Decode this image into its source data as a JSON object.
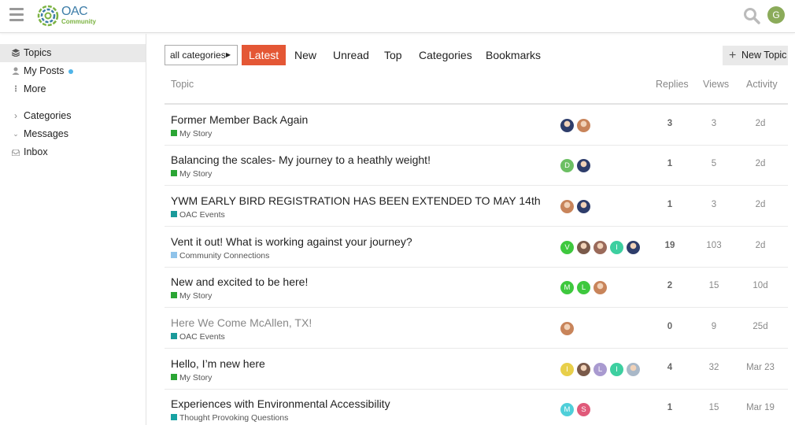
{
  "brand": {
    "logo_main": "OAC",
    "logo_sub": "Community"
  },
  "user": {
    "avatar_letter": "G",
    "avatar_color": "#8bab5a"
  },
  "sidebar": {
    "items": [
      {
        "label": "Topics",
        "icon": "layers-icon"
      },
      {
        "label": "My Posts",
        "icon": "user-icon"
      },
      {
        "label": "More",
        "icon": "more-vertical-icon"
      },
      {
        "label": "Categories",
        "icon": "chevron-right-icon"
      },
      {
        "label": "Messages",
        "icon": "chevron-down-icon"
      },
      {
        "label": "Inbox",
        "icon": "inbox-icon"
      }
    ]
  },
  "nav": {
    "category_filter": "all categories",
    "tabs": [
      "Latest",
      "New",
      "Unread",
      "Top",
      "Categories",
      "Bookmarks"
    ],
    "active_tab": "Latest",
    "new_topic_label": "New Topic"
  },
  "table": {
    "headers": {
      "topic": "Topic",
      "replies": "Replies",
      "views": "Views",
      "activity": "Activity"
    },
    "rows": [
      {
        "title": "Former Member Back Again",
        "category": "My Story",
        "cat_color": "#2aa534",
        "posters": [
          {
            "type": "photo",
            "color": "#2e3d6b"
          },
          {
            "type": "photo",
            "color": "#c8845a"
          }
        ],
        "replies": "3",
        "views": "3",
        "activity": "2d",
        "visited": false
      },
      {
        "title": "Balancing the scales- My journey to a heathly weight!",
        "category": "My Story",
        "cat_color": "#2aa534",
        "posters": [
          {
            "type": "letter",
            "letter": "D",
            "color": "#6cbf63"
          },
          {
            "type": "photo",
            "color": "#2e3d6b"
          }
        ],
        "replies": "1",
        "views": "5",
        "activity": "2d",
        "visited": false
      },
      {
        "title": "YWM EARLY BIRD REGISTRATION HAS BEEN EXTENDED TO MAY 14th",
        "category": "OAC Events",
        "cat_color": "#1a9a9a",
        "posters": [
          {
            "type": "photo",
            "color": "#c8845a"
          },
          {
            "type": "photo",
            "color": "#2e3d6b"
          }
        ],
        "replies": "1",
        "views": "3",
        "activity": "2d",
        "visited": false
      },
      {
        "title": "Vent it out! What is working against your journey?",
        "category": "Community Connections",
        "cat_color": "#8fc3ea",
        "posters": [
          {
            "type": "letter",
            "letter": "V",
            "color": "#3ec83e"
          },
          {
            "type": "photo",
            "color": "#7a5a4a"
          },
          {
            "type": "photo",
            "color": "#9a6a5a"
          },
          {
            "type": "letter",
            "letter": "I",
            "color": "#3dcfa0"
          },
          {
            "type": "photo",
            "color": "#2e3d6b"
          }
        ],
        "replies": "19",
        "views": "103",
        "activity": "2d",
        "visited": false
      },
      {
        "title": "New and excited to be here!",
        "category": "My Story",
        "cat_color": "#2aa534",
        "posters": [
          {
            "type": "letter",
            "letter": "M",
            "color": "#3ec83e"
          },
          {
            "type": "letter",
            "letter": "L",
            "color": "#3ec83e"
          },
          {
            "type": "photo",
            "color": "#c8845a"
          }
        ],
        "replies": "2",
        "views": "15",
        "activity": "10d",
        "visited": false
      },
      {
        "title": "Here We Come McAllen, TX!",
        "category": "OAC Events",
        "cat_color": "#1a9a9a",
        "posters": [
          {
            "type": "photo",
            "color": "#c8845a"
          }
        ],
        "replies": "0",
        "views": "9",
        "activity": "25d",
        "visited": true
      },
      {
        "title": "Hello, I’m new here",
        "category": "My Story",
        "cat_color": "#2aa534",
        "posters": [
          {
            "type": "letter",
            "letter": "I",
            "color": "#e8cf4a"
          },
          {
            "type": "photo",
            "color": "#7a5a4a"
          },
          {
            "type": "letter",
            "letter": "L",
            "color": "#a99ad0"
          },
          {
            "type": "letter",
            "letter": "I",
            "color": "#3dcfa0"
          },
          {
            "type": "photo",
            "color": "#a9b8c8"
          }
        ],
        "replies": "4",
        "views": "32",
        "activity": "Mar 23",
        "visited": false
      },
      {
        "title": "Experiences with Environmental Accessibility",
        "category": "Thought Provoking Questions",
        "cat_color": "#17a2a2",
        "posters": [
          {
            "type": "letter",
            "letter": "M",
            "color": "#4fcfd9"
          },
          {
            "type": "letter",
            "letter": "S",
            "color": "#e05a7a"
          }
        ],
        "replies": "1",
        "views": "15",
        "activity": "Mar 19",
        "visited": false
      }
    ]
  }
}
